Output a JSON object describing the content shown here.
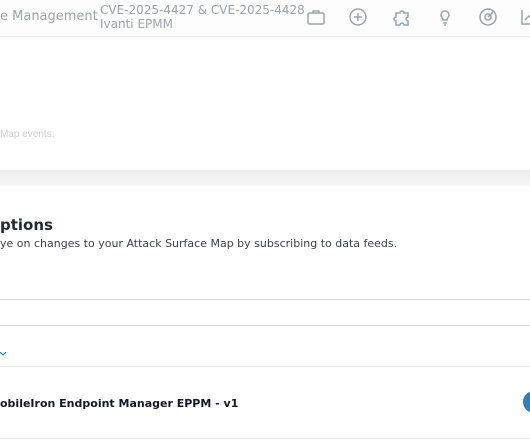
{
  "header": {
    "nav_label": "e Management",
    "cve_line1": "CVE-2025-4427 & CVE-2025-4428",
    "cve_line2": "Ivanti EPMM",
    "icons": [
      "briefcase-icon",
      "plus-circle-icon",
      "puzzle-icon",
      "lightbulb-icon",
      "radar-icon",
      "chart-icon"
    ]
  },
  "background": {
    "faded_text": "Map events."
  },
  "panel": {
    "title": "ptions",
    "description": "ye on changes to your Attack Surface Map by subscribing to data feeds."
  },
  "feed": {
    "label": "obileIron Endpoint Manager EPPM - v1"
  },
  "colors": {
    "accent": "#2f80c1",
    "muted": "#9aa3b0",
    "text": "#1f2937"
  }
}
